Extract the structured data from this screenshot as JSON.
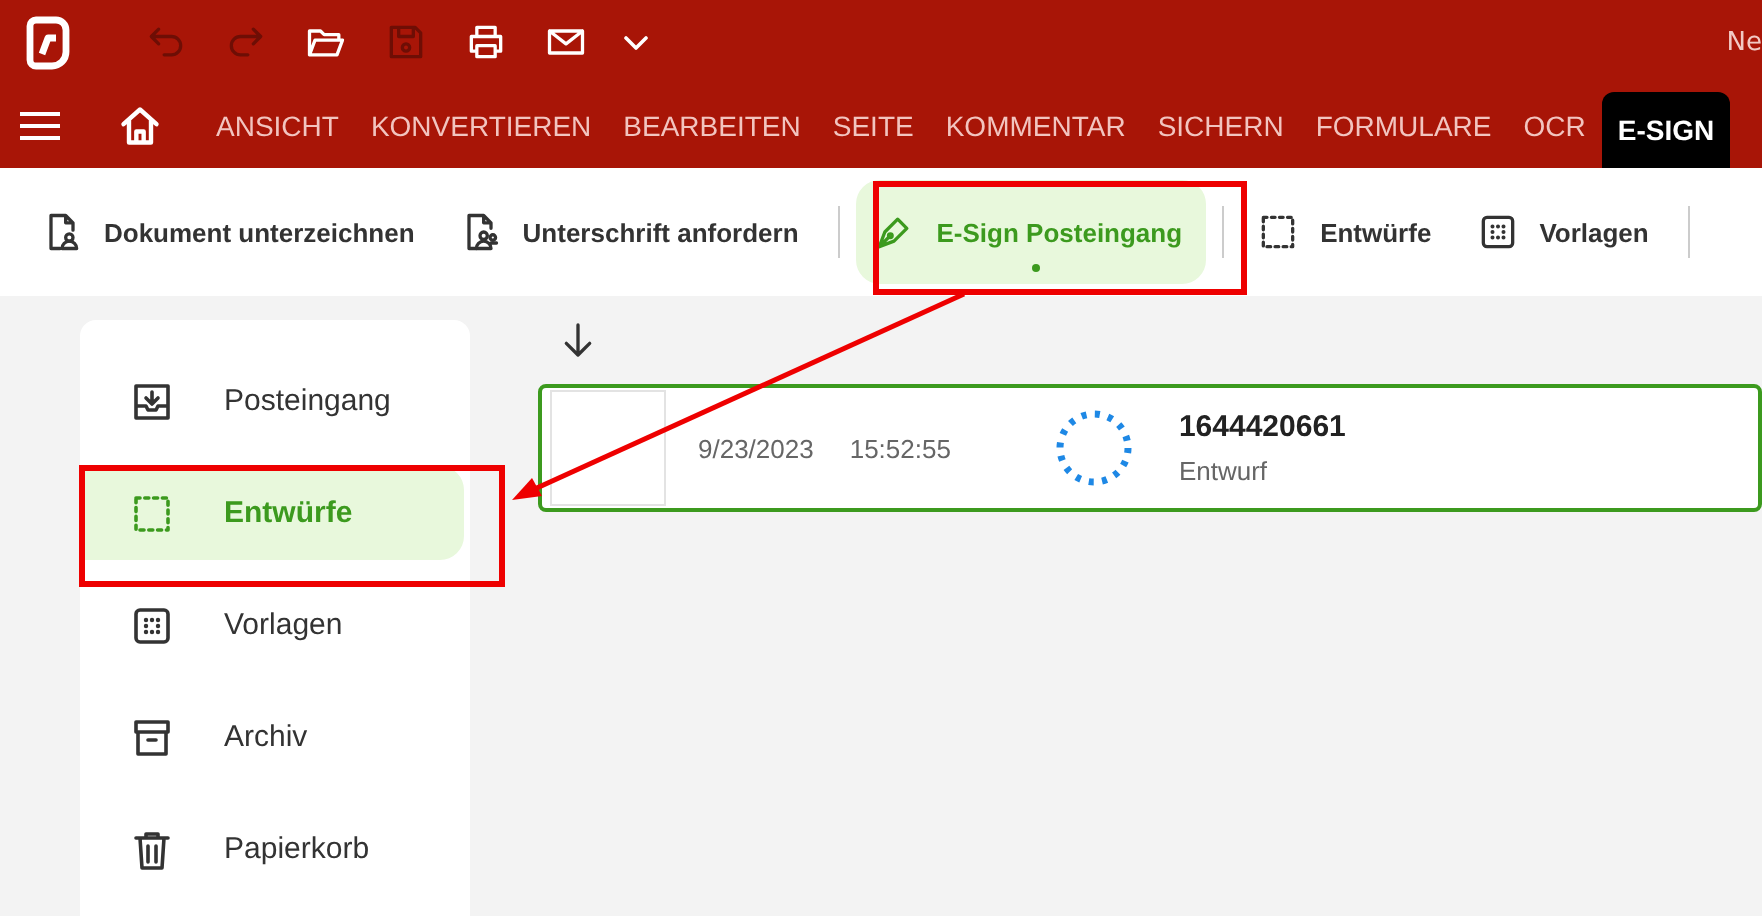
{
  "title_bar": {
    "title": "Ne",
    "quick_actions": [
      {
        "kind": "undo",
        "disabled": true
      },
      {
        "kind": "redo",
        "disabled": true
      },
      {
        "kind": "open",
        "disabled": false
      },
      {
        "kind": "save",
        "disabled": true
      },
      {
        "kind": "print",
        "disabled": false
      },
      {
        "kind": "mail",
        "disabled": false
      },
      {
        "kind": "more",
        "disabled": false
      }
    ]
  },
  "menu_tabs": [
    {
      "label": "ANSICHT",
      "selected": false
    },
    {
      "label": "KONVERTIEREN",
      "selected": false
    },
    {
      "label": "BEARBEITEN",
      "selected": false
    },
    {
      "label": "SEITE",
      "selected": false
    },
    {
      "label": "KOMMENTAR",
      "selected": false
    },
    {
      "label": "SICHERN",
      "selected": false
    },
    {
      "label": "FORMULARE",
      "selected": false
    },
    {
      "label": "OCR",
      "selected": false
    },
    {
      "label": "E-SIGN",
      "selected": true
    }
  ],
  "toolbar": [
    {
      "label": "Dokument unterzeichnen",
      "kind": "sign",
      "selected": false
    },
    {
      "label": "Unterschrift anfordern",
      "kind": "request",
      "selected": false
    },
    {
      "label": "E-Sign Posteingang",
      "kind": "pen",
      "selected": true
    },
    {
      "label": "Entwürfe",
      "kind": "drafts",
      "selected": false
    },
    {
      "label": "Vorlagen",
      "kind": "templates",
      "selected": false
    }
  ],
  "sidebar": {
    "items": [
      {
        "label": "Posteingang",
        "kind": "inbox",
        "selected": false
      },
      {
        "label": "Entwürfe",
        "kind": "drafts",
        "selected": true
      },
      {
        "label": "Vorlagen",
        "kind": "templates",
        "selected": false
      },
      {
        "label": "Archiv",
        "kind": "archive",
        "selected": false
      },
      {
        "label": "Papierkorb",
        "kind": "trash",
        "selected": false
      }
    ]
  },
  "documents": [
    {
      "date": "9/23/2023",
      "time": "15:52:55",
      "name": "1644420661",
      "status": "Entwurf",
      "selected": true
    }
  ]
}
